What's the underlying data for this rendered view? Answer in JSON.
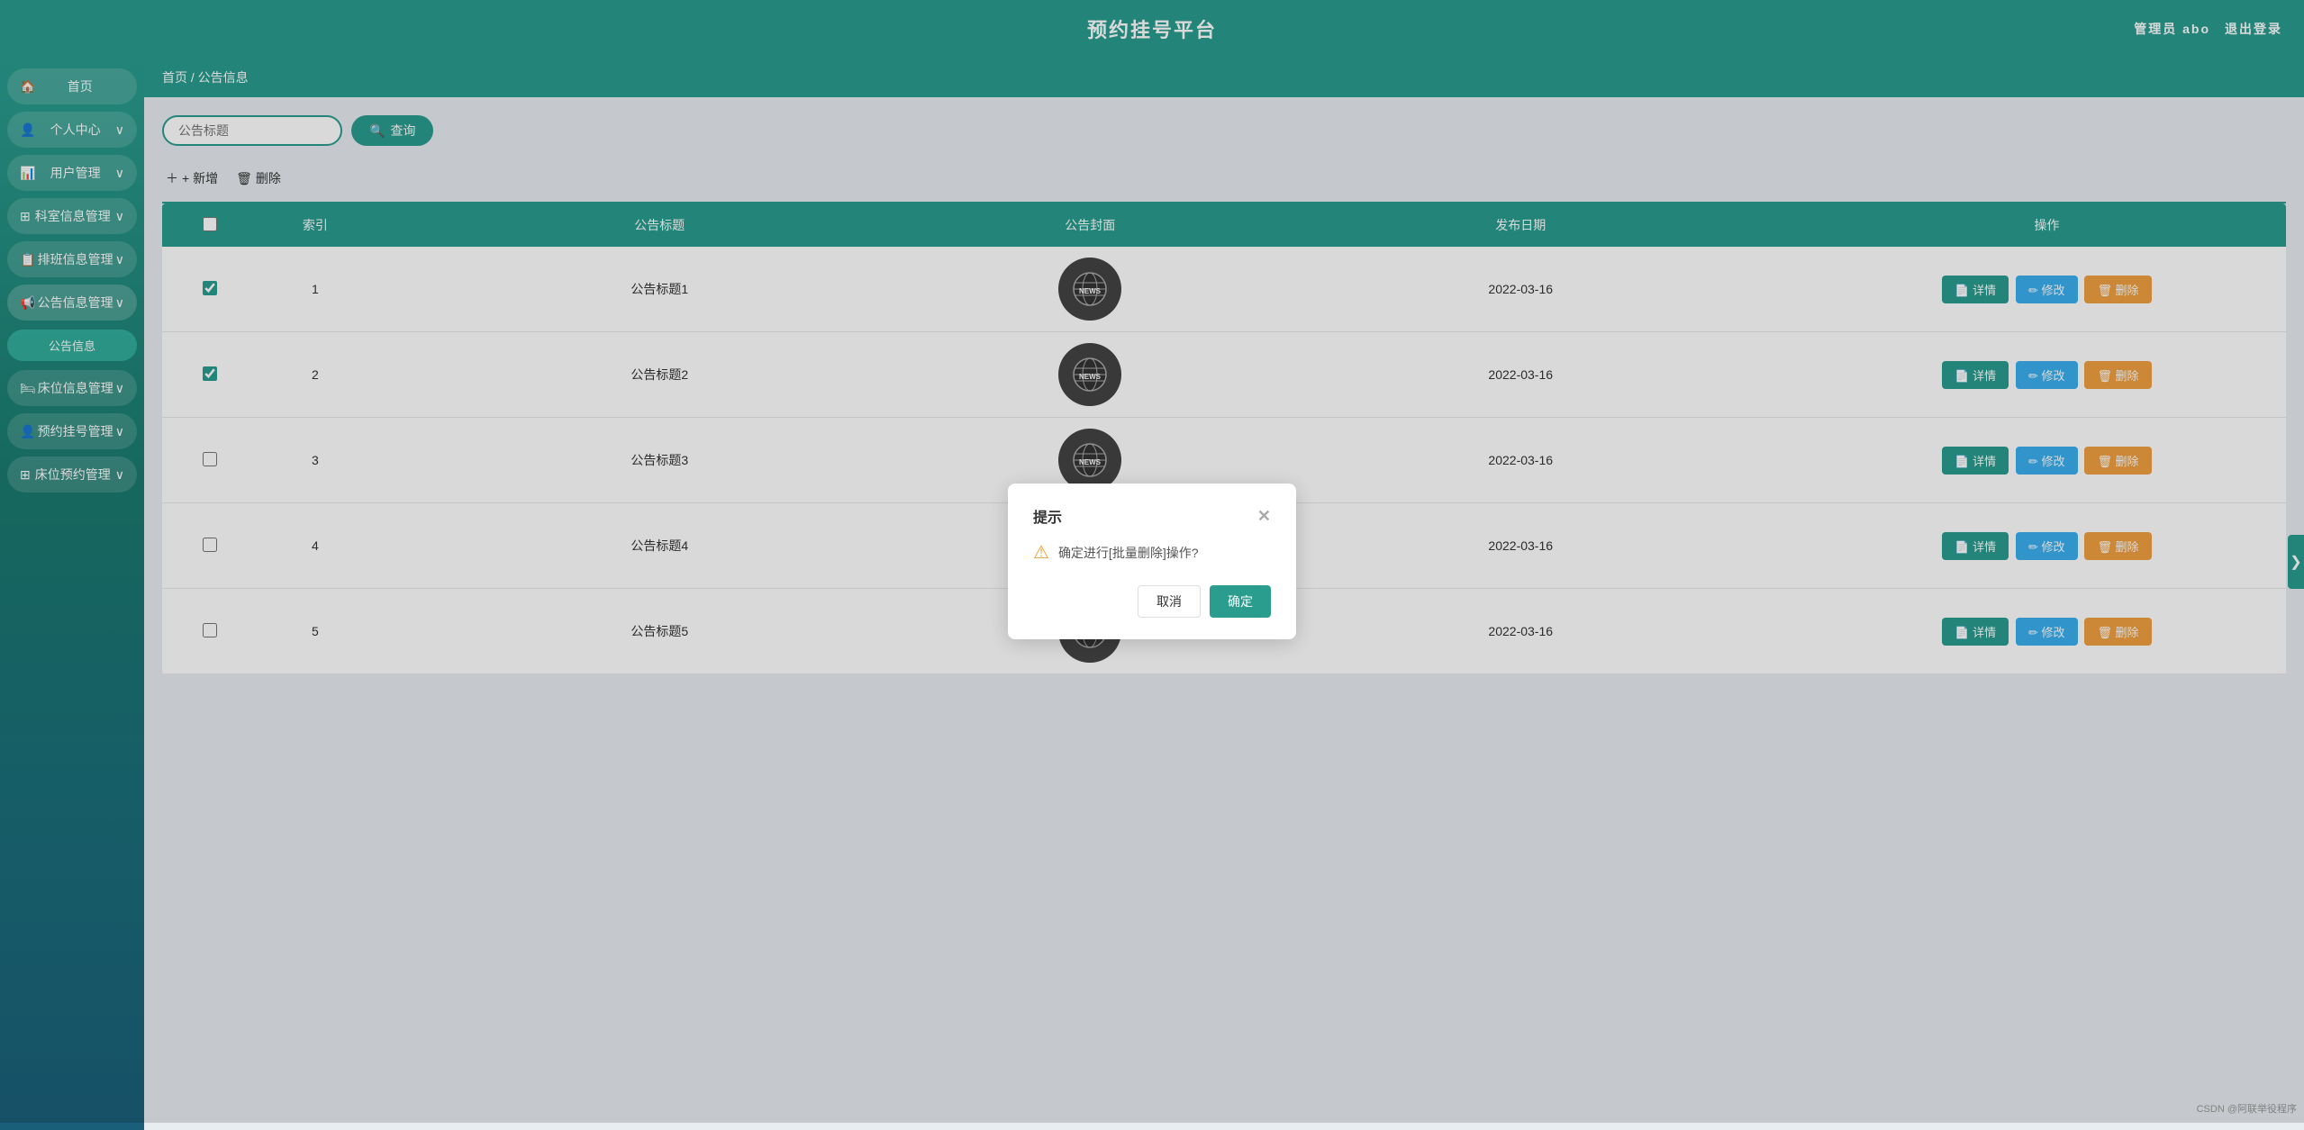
{
  "header": {
    "title": "预约挂号平台",
    "admin_label": "管理员 abo",
    "logout_label": "退出登录"
  },
  "breadcrumb": {
    "home": "首页",
    "separator": "/",
    "current": "公告信息"
  },
  "search": {
    "placeholder": "公告标题",
    "button_label": "查询"
  },
  "toolbar": {
    "add_label": "+ 新增",
    "delete_label": "删除"
  },
  "table": {
    "columns": [
      "索引",
      "公告标题",
      "公告封面",
      "发布日期",
      "操作"
    ],
    "rows": [
      {
        "id": 1,
        "title": "公告标题1",
        "date": "2022-03-16",
        "checked": true
      },
      {
        "id": 2,
        "title": "公告标题2",
        "date": "2022-03-16",
        "checked": true
      },
      {
        "id": 3,
        "title": "公告标题3",
        "date": "2022-03-16",
        "checked": false
      },
      {
        "id": 4,
        "title": "公告标题4",
        "date": "2022-03-16",
        "checked": false
      },
      {
        "id": 5,
        "title": "公告标题5",
        "date": "2022-03-16",
        "checked": false
      }
    ],
    "detail_btn": "详情",
    "edit_btn": "修改",
    "delete_btn": "删除"
  },
  "modal": {
    "title": "提示",
    "message": "确定进行[批量删除]操作?",
    "cancel_label": "取消",
    "confirm_label": "确定"
  },
  "sidebar": {
    "items": [
      {
        "key": "home",
        "icon": "🏠",
        "label": "首页",
        "has_sub": false
      },
      {
        "key": "personal",
        "icon": "👤",
        "label": "个人中心",
        "has_sub": true
      },
      {
        "key": "user_mgmt",
        "icon": "📊",
        "label": "用户管理",
        "has_sub": true
      },
      {
        "key": "dept_mgmt",
        "icon": "⊞",
        "label": "科室信息管理",
        "has_sub": true
      },
      {
        "key": "schedule_mgmt",
        "icon": "📋",
        "label": "排班信息管理",
        "has_sub": true
      },
      {
        "key": "notice_mgmt",
        "icon": "📢",
        "label": "公告信息管理",
        "has_sub": true
      },
      {
        "key": "notice_info",
        "icon": "",
        "label": "公告信息",
        "is_sub": true
      },
      {
        "key": "bed_mgmt",
        "icon": "🛏",
        "label": "床位信息管理",
        "has_sub": true
      },
      {
        "key": "appt_mgmt",
        "icon": "👤",
        "label": "预约挂号管理",
        "has_sub": true
      },
      {
        "key": "bed_appt_mgmt",
        "icon": "⊞",
        "label": "床位预约管理",
        "has_sub": true
      }
    ]
  },
  "watermark": "CSDN @阿联举役程序",
  "colors": {
    "primary": "#2a9d8f",
    "btn_edit": "#3aafef",
    "btn_delete": "#f0a040"
  }
}
